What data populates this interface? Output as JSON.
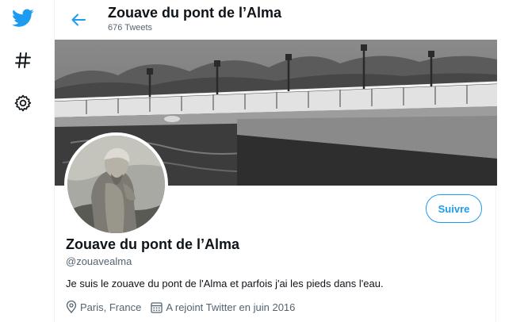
{
  "nav": {
    "icons": [
      "twitter-bird-icon",
      "hashtag-icon",
      "gear-icon"
    ]
  },
  "header": {
    "title": "Zouave du pont de l’Alma",
    "tweet_count": "676 Tweets"
  },
  "profile": {
    "display_name": "Zouave du pont de l’Alma",
    "handle": "@zouavealma",
    "bio": "Je suis le zouave du pont de l'Alma et parfois j'ai les pieds dans l'eau.",
    "location": "Paris, France",
    "joined": "A rejoint Twitter en juin 2016",
    "follow_label": "Suivre"
  },
  "colors": {
    "accent": "#1d9bf0",
    "text": "#0f1419",
    "muted": "#536471"
  }
}
